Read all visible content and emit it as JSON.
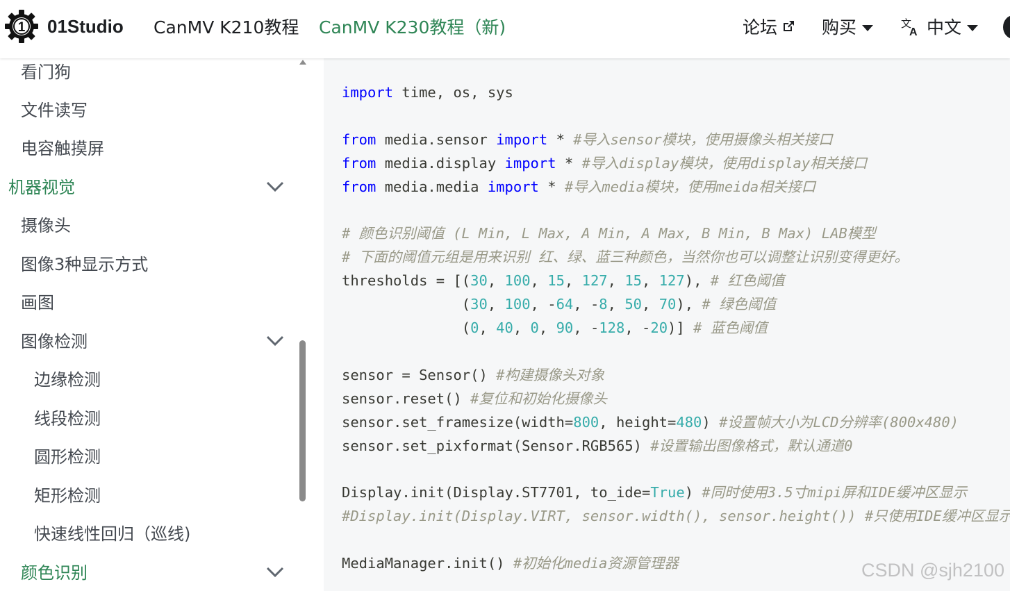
{
  "navbar": {
    "brand": "01Studio",
    "links": [
      "CanMV K210教程",
      "CanMV K230教程（新)"
    ],
    "forum": "论坛",
    "buy": "购买",
    "language": "中文",
    "icons": {
      "logo": "gear-1-logo",
      "forum": "external-link-icon",
      "language": "translate-icon",
      "theme": "theme-toggle-icon"
    },
    "active_color": "#2e8555"
  },
  "sidebar": {
    "items": [
      {
        "label": "看门狗",
        "level": 1
      },
      {
        "label": "文件读写",
        "level": 1
      },
      {
        "label": "电容触摸屏",
        "level": 1
      },
      {
        "label": "机器视觉",
        "level": 0,
        "category": true,
        "expanded": true
      },
      {
        "label": "摄像头",
        "level": 1
      },
      {
        "label": "图像3种显示方式",
        "level": 1
      },
      {
        "label": "画图",
        "level": 1
      },
      {
        "label": "图像检测",
        "level": 1,
        "expanded": true
      },
      {
        "label": "边缘检测",
        "level": 2
      },
      {
        "label": "线段检测",
        "level": 2
      },
      {
        "label": "圆形检测",
        "level": 2
      },
      {
        "label": "矩形检测",
        "level": 2
      },
      {
        "label": "快速线性回归（巡线)",
        "level": 2
      },
      {
        "label": "颜色识别",
        "level": 1,
        "category": true,
        "expanded": true
      }
    ]
  },
  "code": {
    "lines": [
      [
        [
          "kw",
          "import"
        ],
        [
          "t",
          " time, os, sys"
        ]
      ],
      [],
      [
        [
          "kw",
          "from"
        ],
        [
          "t",
          " media.sensor "
        ],
        [
          "kw",
          "import"
        ],
        [
          "t",
          " * "
        ],
        [
          "cm",
          "#导入sensor模块，使用摄像头相关接口"
        ]
      ],
      [
        [
          "kw",
          "from"
        ],
        [
          "t",
          " media.display "
        ],
        [
          "kw",
          "import"
        ],
        [
          "t",
          " * "
        ],
        [
          "cm",
          "#导入display模块，使用display相关接口"
        ]
      ],
      [
        [
          "kw",
          "from"
        ],
        [
          "t",
          " media.media "
        ],
        [
          "kw",
          "import"
        ],
        [
          "t",
          " * "
        ],
        [
          "cm",
          "#导入media模块，使用meida相关接口"
        ]
      ],
      [],
      [
        [
          "cm",
          "# 颜色识别阈值 (L Min, L Max, A Min, A Max, B Min, B Max) LAB模型"
        ]
      ],
      [
        [
          "cm",
          "# 下面的阈值元组是用来识别 红、绿、蓝三种颜色，当然你也可以调整让识别变得更好。"
        ]
      ],
      [
        [
          "t",
          "thresholds = [("
        ],
        [
          "num",
          "30"
        ],
        [
          "t",
          ", "
        ],
        [
          "num",
          "100"
        ],
        [
          "t",
          ", "
        ],
        [
          "num",
          "15"
        ],
        [
          "t",
          ", "
        ],
        [
          "num",
          "127"
        ],
        [
          "t",
          ", "
        ],
        [
          "num",
          "15"
        ],
        [
          "t",
          ", "
        ],
        [
          "num",
          "127"
        ],
        [
          "t",
          "), "
        ],
        [
          "cm",
          "# 红色阈值"
        ]
      ],
      [
        [
          "t",
          "              ("
        ],
        [
          "num",
          "30"
        ],
        [
          "t",
          ", "
        ],
        [
          "num",
          "100"
        ],
        [
          "t",
          ", -"
        ],
        [
          "num",
          "64"
        ],
        [
          "t",
          ", -"
        ],
        [
          "num",
          "8"
        ],
        [
          "t",
          ", "
        ],
        [
          "num",
          "50"
        ],
        [
          "t",
          ", "
        ],
        [
          "num",
          "70"
        ],
        [
          "t",
          "), "
        ],
        [
          "cm",
          "# 绿色阈值"
        ]
      ],
      [
        [
          "t",
          "              ("
        ],
        [
          "num",
          "0"
        ],
        [
          "t",
          ", "
        ],
        [
          "num",
          "40"
        ],
        [
          "t",
          ", "
        ],
        [
          "num",
          "0"
        ],
        [
          "t",
          ", "
        ],
        [
          "num",
          "90"
        ],
        [
          "t",
          ", -"
        ],
        [
          "num",
          "128"
        ],
        [
          "t",
          ", -"
        ],
        [
          "num",
          "20"
        ],
        [
          "t",
          ")] "
        ],
        [
          "cm",
          "# 蓝色阈值"
        ]
      ],
      [],
      [
        [
          "t",
          "sensor = Sensor() "
        ],
        [
          "cm",
          "#构建摄像头对象"
        ]
      ],
      [
        [
          "t",
          "sensor.reset() "
        ],
        [
          "cm",
          "#复位和初始化摄像头"
        ]
      ],
      [
        [
          "t",
          "sensor.set_framesize(width="
        ],
        [
          "num",
          "800"
        ],
        [
          "t",
          ", height="
        ],
        [
          "num",
          "480"
        ],
        [
          "t",
          ") "
        ],
        [
          "cm",
          "#设置帧大小为LCD分辨率(800x480)"
        ]
      ],
      [
        [
          "t",
          "sensor.set_pixformat(Sensor.RGB565) "
        ],
        [
          "cm",
          "#设置输出图像格式，默认通道0"
        ]
      ],
      [],
      [
        [
          "t",
          "Display.init(Display.ST7701, to_ide="
        ],
        [
          "num",
          "True"
        ],
        [
          "t",
          ") "
        ],
        [
          "cm",
          "#同时使用3.5寸mipi屏和IDE缓冲区显示"
        ]
      ],
      [
        [
          "cm",
          "#Display.init(Display.VIRT, sensor.width(), sensor.height()) #只使用IDE缓冲区显示"
        ]
      ],
      [],
      [
        [
          "t",
          "MediaManager.init() "
        ],
        [
          "cm",
          "#初始化media资源管理器"
        ]
      ]
    ]
  },
  "watermark": "CSDN @sjh2100"
}
